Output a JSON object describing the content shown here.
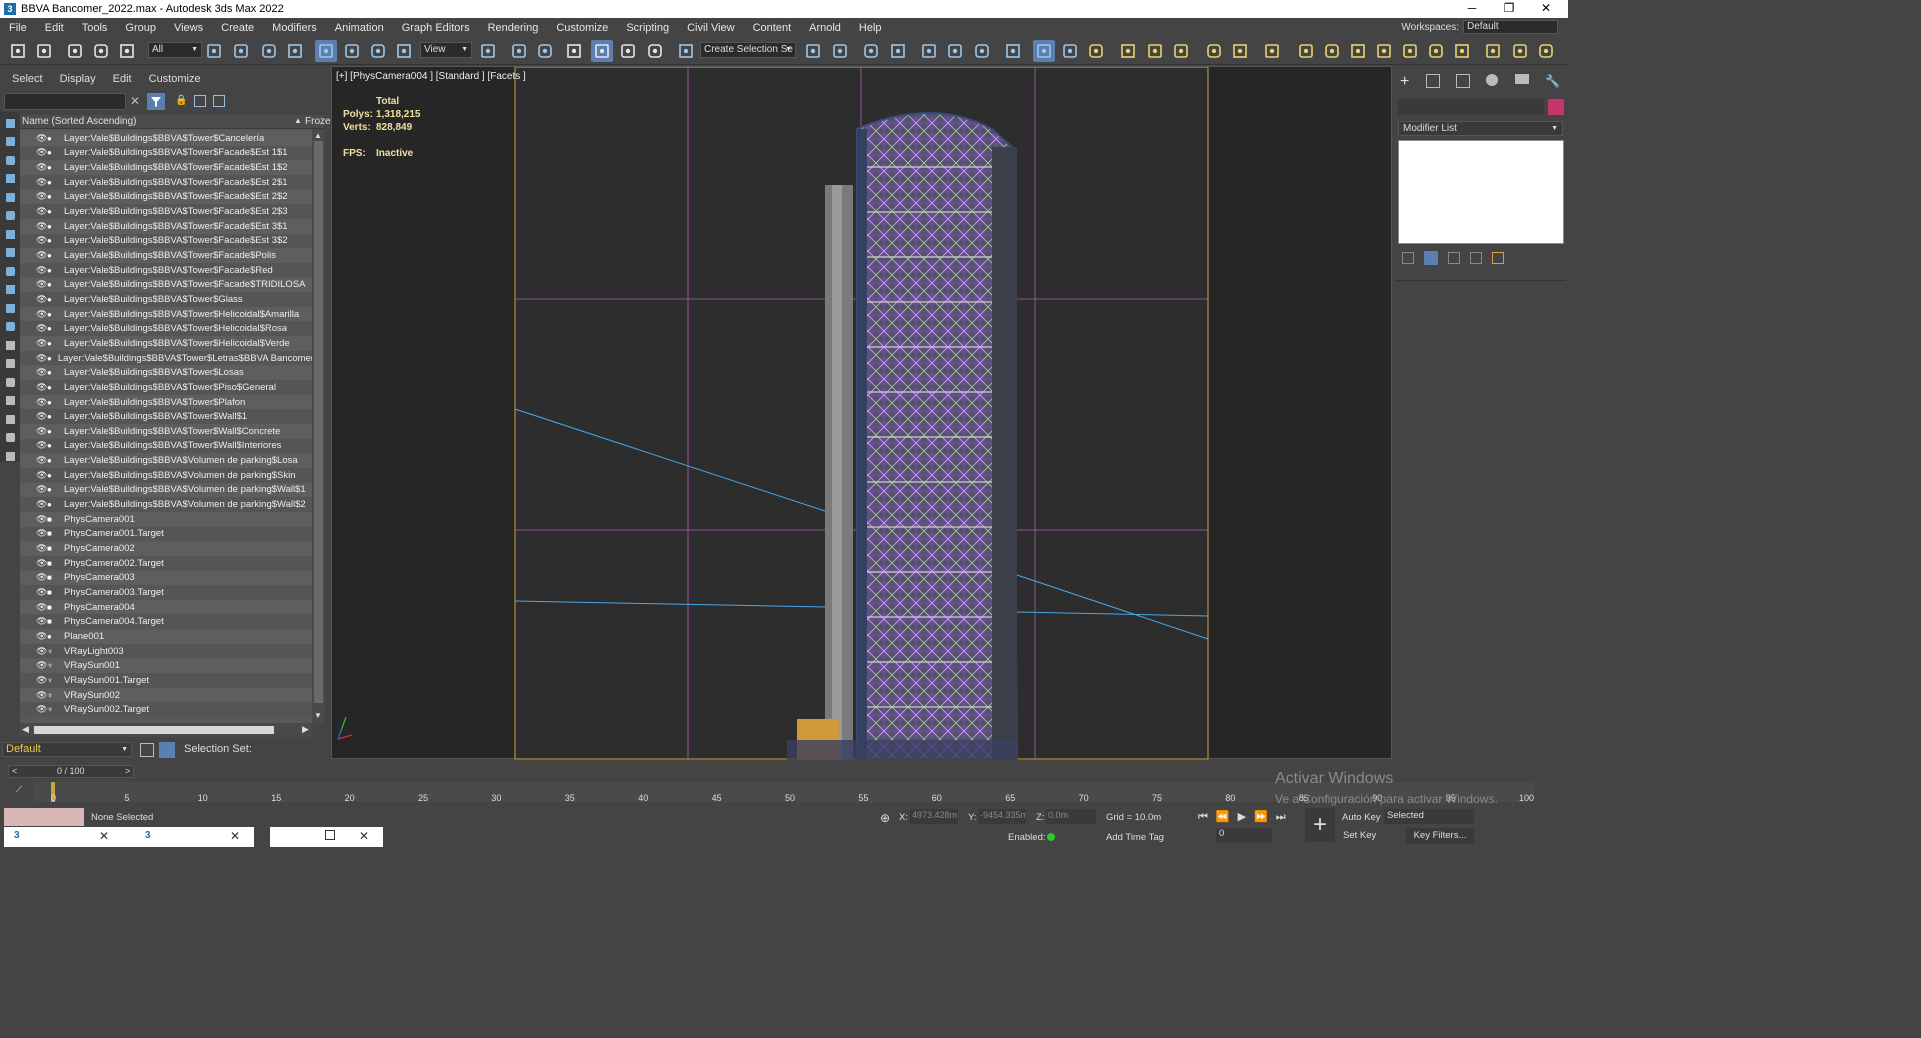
{
  "window": {
    "title": "BBVA Bancomer_2022.max - Autodesk 3ds Max 2022",
    "minimize": "─",
    "restore": "❐",
    "close": "✕",
    "app_icon": "3"
  },
  "menu": [
    "File",
    "Edit",
    "Tools",
    "Group",
    "Views",
    "Create",
    "Modifiers",
    "Animation",
    "Graph Editors",
    "Rendering",
    "Customize",
    "Scripting",
    "Civil View",
    "Content",
    "Arnold",
    "Help"
  ],
  "workspaces": {
    "label": "Workspaces:",
    "value": "Default"
  },
  "toolbar": {
    "filter_value": "All",
    "refcoord_value": "View",
    "selection_set": "Create Selection Se"
  },
  "scene_explorer": {
    "menu": [
      "Select",
      "Display",
      "Edit",
      "Customize"
    ],
    "search_placeholder": "",
    "column_header": "Name (Sorted Ascending)",
    "sort_arrow": "▲",
    "frozen_header": "Froze",
    "items": [
      "Layer:Vale$Buildings$BBVA$Tower$Cancelería",
      "Layer:Vale$Buildings$BBVA$Tower$Facade$Est 1$1",
      "Layer:Vale$Buildings$BBVA$Tower$Facade$Est 1$2",
      "Layer:Vale$Buildings$BBVA$Tower$Facade$Est 2$1",
      "Layer:Vale$Buildings$BBVA$Tower$Facade$Est 2$2",
      "Layer:Vale$Buildings$BBVA$Tower$Facade$Est 2$3",
      "Layer:Vale$Buildings$BBVA$Tower$Facade$Est 3$1",
      "Layer:Vale$Buildings$BBVA$Tower$Facade$Est 3$2",
      "Layer:Vale$Buildings$BBVA$Tower$Facade$Polis",
      "Layer:Vale$Buildings$BBVA$Tower$Facade$Red",
      "Layer:Vale$Buildings$BBVA$Tower$Facade$TRIDILOSA",
      "Layer:Vale$Buildings$BBVA$Tower$Glass",
      "Layer:Vale$Buildings$BBVA$Tower$Helicoidal$Amarilla",
      "Layer:Vale$Buildings$BBVA$Tower$Helicoidal$Rosa",
      "Layer:Vale$Buildings$BBVA$Tower$Helicoidal$Verde",
      "Layer:Vale$Buildings$BBVA$Tower$Letras$BBVA Bancomer",
      "Layer:Vale$Buildings$BBVA$Tower$Losas",
      "Layer:Vale$Buildings$BBVA$Tower$Piso$General",
      "Layer:Vale$Buildings$BBVA$Tower$Plafon",
      "Layer:Vale$Buildings$BBVA$Tower$Wall$1",
      "Layer:Vale$Buildings$BBVA$Tower$Wall$Concrete",
      "Layer:Vale$Buildings$BBVA$Tower$Wall$Interiores",
      "Layer:Vale$Buildings$BBVA$Volumen de parking$Losa",
      "Layer:Vale$Buildings$BBVA$Volumen de parking$Skin",
      "Layer:Vale$Buildings$BBVA$Volumen de parking$Wall$1",
      "Layer:Vale$Buildings$BBVA$Volumen de parking$Wall$2",
      "PhysCamera001",
      "PhysCamera001.Target",
      "PhysCamera002",
      "PhysCamera002.Target",
      "PhysCamera003",
      "PhysCamera003.Target",
      "PhysCamera004",
      "PhysCamera004.Target",
      "Plane001",
      "VRayLight003",
      "VRaySun001",
      "VRaySun001.Target",
      "VRaySun002",
      "VRaySun002.Target"
    ],
    "item_types": [
      "geo",
      "geo",
      "geo",
      "geo",
      "geo",
      "geo",
      "geo",
      "geo",
      "geo",
      "geo",
      "geo",
      "geo",
      "geo",
      "geo",
      "geo",
      "geo",
      "geo",
      "geo",
      "geo",
      "geo",
      "geo",
      "geo",
      "geo",
      "geo",
      "geo",
      "geo",
      "cam",
      "cam",
      "cam",
      "cam",
      "cam",
      "cam",
      "cam",
      "cam",
      "geo",
      "light",
      "light",
      "light",
      "light",
      "light"
    ]
  },
  "layer_bar": {
    "layer": "Default",
    "selection_set_label": "Selection Set:"
  },
  "viewport": {
    "label": "[+] [PhysCamera004 ] [Standard ] [Facets ]",
    "stats_total": "Total",
    "polys_label": "Polys:",
    "polys_value": "1,318,215",
    "verts_label": "Verts:",
    "verts_value": "828,849",
    "fps_label": "FPS:",
    "fps_value": "Inactive"
  },
  "command_panel": {
    "modifier_list": "Modifier List",
    "accent_color": "#c8356c"
  },
  "timeline": {
    "frame_counter": "0 / 100",
    "prev": "<",
    "next": ">",
    "ticks": [
      "0",
      "5",
      "10",
      "15",
      "20",
      "25",
      "30",
      "35",
      "40",
      "45",
      "50",
      "55",
      "60",
      "65",
      "70",
      "75",
      "80",
      "85",
      "90",
      "95",
      "100"
    ]
  },
  "status": {
    "selection": "None Selected",
    "x_label": "X:",
    "x_value": "4973.428m",
    "y_label": "Y:",
    "y_value": "-9454.335m",
    "z_label": "Z:",
    "z_value": "0.0m",
    "grid": "Grid = 10.0m",
    "enabled_label": "Enabled:",
    "add_time_tag": "Add Time Tag",
    "auto_key": "Auto Key",
    "set_key": "Set Key",
    "selected_value": "Selected",
    "key_filters": "Key Filters...",
    "current_frame": "0",
    "watermark_title": "Activar Windows",
    "watermark_sub": "Ve a Configuración para activar Windows."
  },
  "colors": {
    "selection_blue": "#5b7fb0",
    "viewport_bg": "#262626",
    "frame_yellow": "#c8a63c"
  }
}
